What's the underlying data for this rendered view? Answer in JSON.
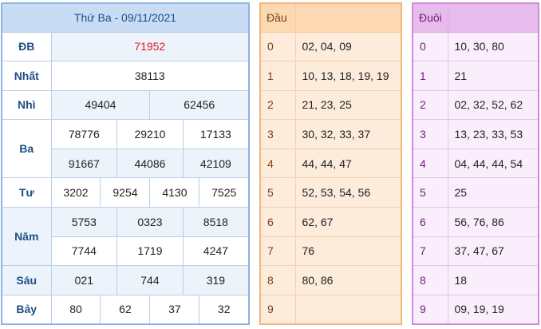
{
  "results": {
    "header": "Thứ Ba - 09/11/2021",
    "labels": {
      "db": "ĐB",
      "nhat": "Nhất",
      "nhi": "Nhì",
      "ba": "Ba",
      "tu": "Tư",
      "nam": "Năm",
      "sau": "Sáu",
      "bay": "Bảy"
    },
    "db": [
      "71952"
    ],
    "nhat": [
      "38113"
    ],
    "nhi": [
      "49404",
      "62456"
    ],
    "ba": [
      "78776",
      "29210",
      "17133",
      "91667",
      "44086",
      "42109"
    ],
    "tu": [
      "3202",
      "9254",
      "4130",
      "7525"
    ],
    "nam": [
      "5753",
      "0323",
      "8518",
      "7744",
      "1719",
      "4247"
    ],
    "sau": [
      "021",
      "744",
      "319"
    ],
    "bay": [
      "80",
      "62",
      "37",
      "32"
    ],
    "colors": {
      "special": "#e3191b",
      "label": "#1f4e87",
      "header_bg": "#c8dcf3"
    }
  },
  "dau": {
    "header": "Đầu",
    "rows": [
      {
        "k": "0",
        "v": "02, 04, 09"
      },
      {
        "k": "1",
        "v": "10, 13, 18, 19, 19"
      },
      {
        "k": "2",
        "v": "21, 23, 25"
      },
      {
        "k": "3",
        "v": "30, 32, 33, 37"
      },
      {
        "k": "4",
        "v": "44, 44, 47"
      },
      {
        "k": "5",
        "v": "52, 53, 54, 56"
      },
      {
        "k": "6",
        "v": "62, 67"
      },
      {
        "k": "7",
        "v": "76"
      },
      {
        "k": "8",
        "v": "80, 86"
      },
      {
        "k": "9",
        "v": ""
      }
    ]
  },
  "duoi": {
    "header": "Đuôi",
    "rows": [
      {
        "k": "0",
        "v": "10, 30, 80"
      },
      {
        "k": "1",
        "v": "21"
      },
      {
        "k": "2",
        "v": "02, 32, 52, 62"
      },
      {
        "k": "3",
        "v": "13, 23, 33, 53"
      },
      {
        "k": "4",
        "v": "04, 44, 44, 54"
      },
      {
        "k": "5",
        "v": "25"
      },
      {
        "k": "6",
        "v": "56, 76, 86"
      },
      {
        "k": "7",
        "v": "37, 47, 67"
      },
      {
        "k": "8",
        "v": "18"
      },
      {
        "k": "9",
        "v": "09, 19, 19"
      }
    ]
  }
}
